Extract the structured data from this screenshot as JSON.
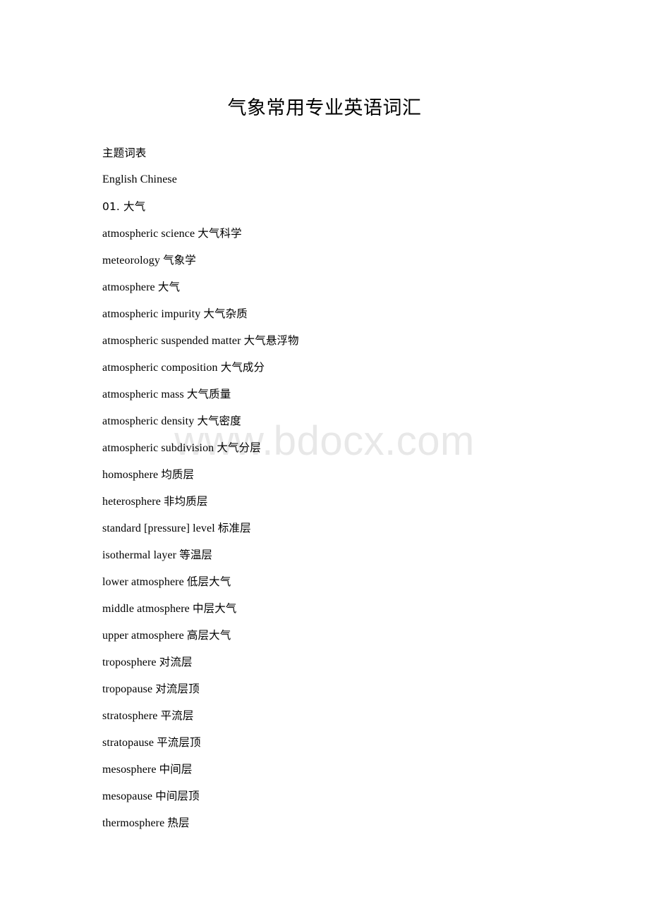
{
  "document": {
    "title": "气象常用专业英语词汇",
    "watermark": "www.bdocx.com",
    "watermark_color": "#e8e8e8",
    "text_color": "#000000",
    "background_color": "#ffffff"
  },
  "preamble": {
    "subject_list_label": "主题词表",
    "column_header": "English Chinese",
    "section_number_label": "01. 大气"
  },
  "glossary": {
    "section": "01. 大气",
    "entries": [
      {
        "english": "atmospheric science",
        "chinese": "大气科学"
      },
      {
        "english": "meteorology",
        "chinese": "气象学"
      },
      {
        "english": "atmosphere",
        "chinese": "大气"
      },
      {
        "english": "atmospheric impurity",
        "chinese": "大气杂质"
      },
      {
        "english": "atmospheric suspended matter",
        "chinese": "大气悬浮物"
      },
      {
        "english": "atmospheric composition",
        "chinese": "大气成分"
      },
      {
        "english": "atmospheric mass",
        "chinese": "大气质量"
      },
      {
        "english": "atmospheric density",
        "chinese": "大气密度"
      },
      {
        "english": "atmospheric subdivision",
        "chinese": "大气分层"
      },
      {
        "english": "homosphere",
        "chinese": "均质层"
      },
      {
        "english": "heterosphere",
        "chinese": "非均质层"
      },
      {
        "english": "standard [pressure] level",
        "chinese": "标准层"
      },
      {
        "english": "isothermal layer",
        "chinese": "等温层"
      },
      {
        "english": "lower atmosphere",
        "chinese": "低层大气"
      },
      {
        "english": "middle atmosphere",
        "chinese": "中层大气"
      },
      {
        "english": "upper atmosphere",
        "chinese": "高层大气"
      },
      {
        "english": "troposphere",
        "chinese": "对流层"
      },
      {
        "english": "tropopause",
        "chinese": "对流层顶"
      },
      {
        "english": "stratosphere",
        "chinese": "平流层"
      },
      {
        "english": "stratopause",
        "chinese": "平流层顶"
      },
      {
        "english": "mesosphere",
        "chinese": "中间层"
      },
      {
        "english": "mesopause",
        "chinese": "中间层顶"
      },
      {
        "english": "thermosphere",
        "chinese": "热层"
      }
    ]
  }
}
